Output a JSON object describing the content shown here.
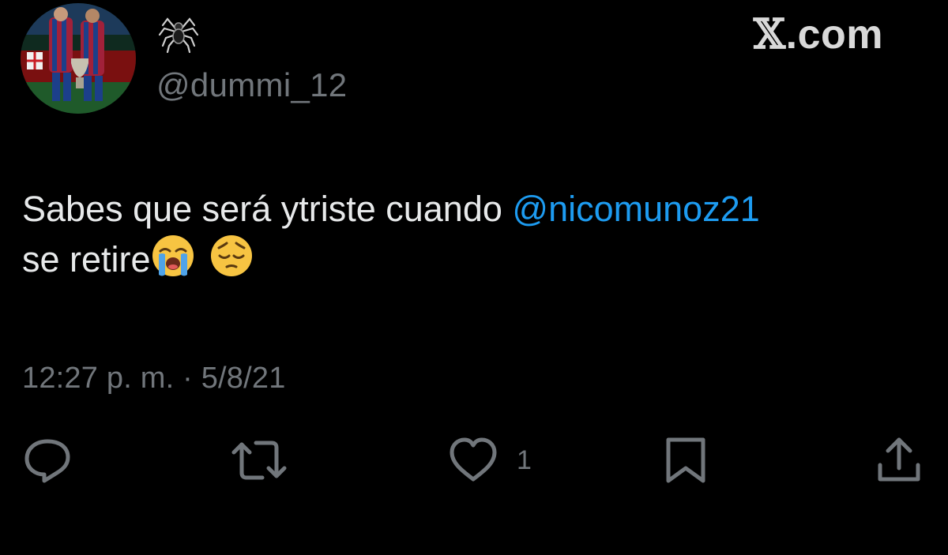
{
  "user": {
    "display_name": "🕷",
    "handle": "@dummi_12",
    "avatar_icon": "profile-photo"
  },
  "brand": {
    "x_letter": "𝕏",
    "domain_suffix": ".com"
  },
  "tweet": {
    "text_before": "Sabes que será ytriste cuando ",
    "mention": "@nicomunoz21",
    "text_line2": "se retire",
    "emoji_1": "loudly-crying-face",
    "emoji_2": "pensive-face"
  },
  "timestamp": {
    "time": "12:27",
    "period": "p. m.",
    "separator": " · ",
    "date": "5/8/21"
  },
  "actions": {
    "reply_icon": "reply-icon",
    "retweet_icon": "retweet-icon",
    "like_icon": "heart-icon",
    "like_count": "1",
    "bookmark_icon": "bookmark-icon",
    "share_icon": "share-icon"
  },
  "colors": {
    "background": "#000000",
    "text": "#e7e9ea",
    "secondary": "#71767b",
    "mention": "#1d9bf0"
  }
}
